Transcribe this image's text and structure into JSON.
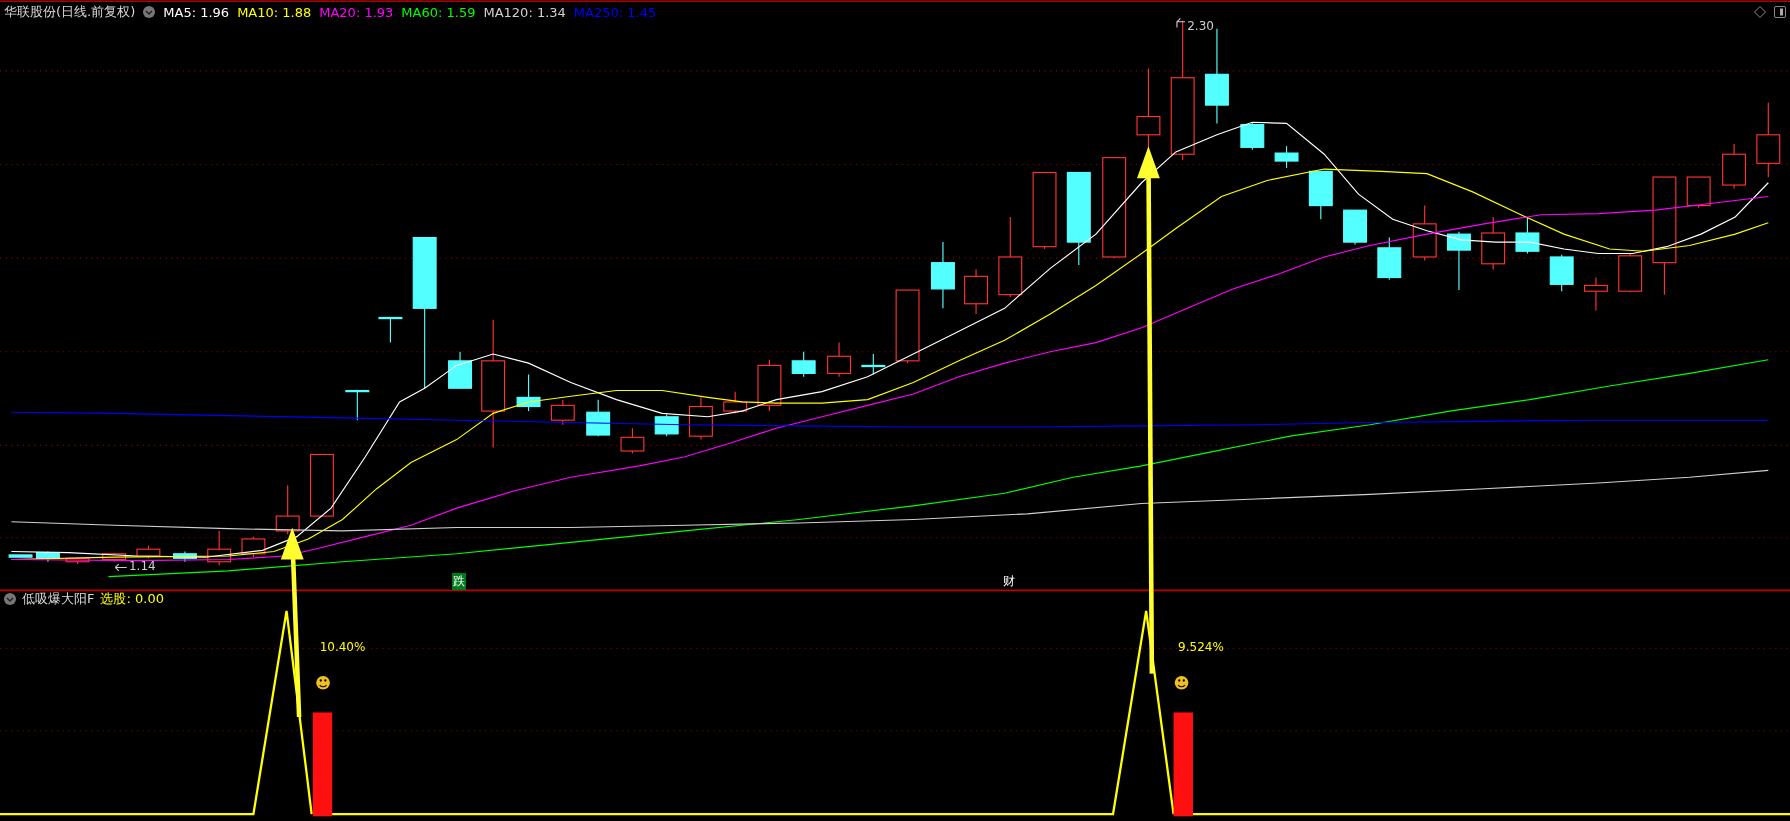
{
  "main_panel": {
    "title": "华联股份(日线.前复权)",
    "moving_averages": [
      {
        "label": "MA5: 1.96",
        "color": "#ffffff"
      },
      {
        "label": "MA10: 1.88",
        "color": "#ffff00"
      },
      {
        "label": "MA20: 1.93",
        "color": "#ff00ff"
      },
      {
        "label": "MA60: 1.59",
        "color": "#00ff00"
      },
      {
        "label": "MA120: 1.34",
        "color": "#d0d0d0"
      },
      {
        "label": "MA250: 1.45",
        "color": "#0000ff"
      }
    ],
    "high_label": "2.30",
    "low_label": "1.14",
    "markers": [
      {
        "text": "跌",
        "kind": "boxed"
      },
      {
        "text": "财",
        "kind": "plain"
      }
    ]
  },
  "indicator_panel": {
    "title": "低吸爆大阳F",
    "value": "选股: 0.00",
    "signals": [
      {
        "percent": "10.40%"
      },
      {
        "percent": "9.524%"
      }
    ]
  }
}
